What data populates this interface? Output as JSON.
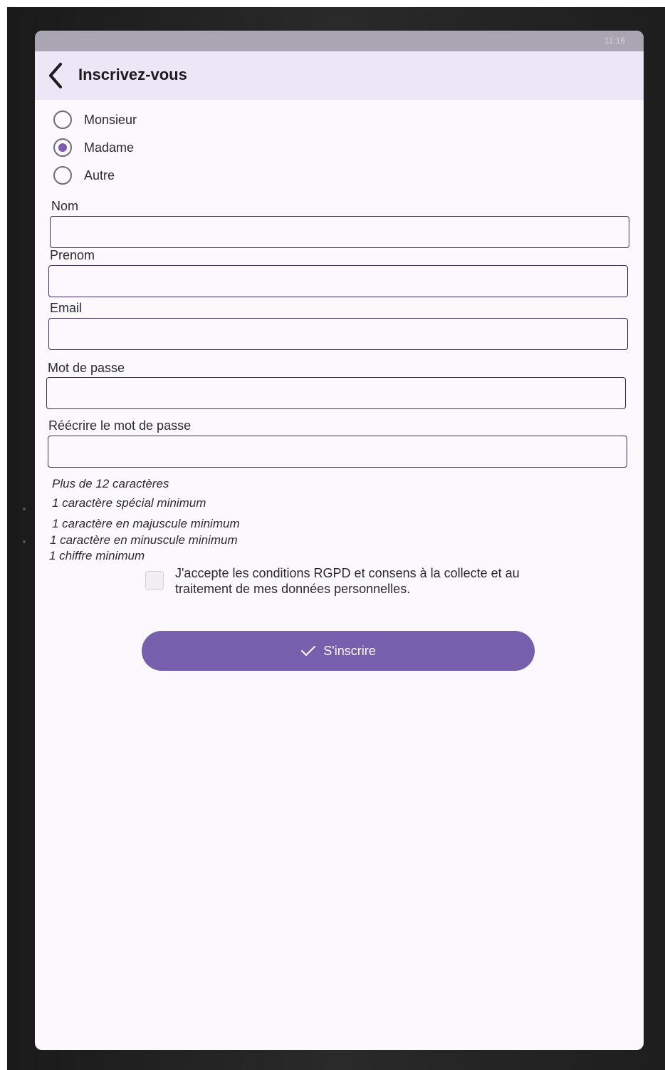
{
  "status_bar": {
    "time": "11:16"
  },
  "app_bar": {
    "title": "Inscrivez-vous",
    "back_icon": "chevron-left-icon"
  },
  "civility": {
    "options": [
      {
        "label": "Monsieur",
        "selected": false
      },
      {
        "label": "Madame",
        "selected": true
      },
      {
        "label": "Autre",
        "selected": false
      }
    ]
  },
  "form": {
    "nom": {
      "label": "Nom",
      "value": ""
    },
    "prenom": {
      "label": "Prenom",
      "value": ""
    },
    "email": {
      "label": "Email",
      "value": ""
    },
    "password": {
      "label": "Mot de passe",
      "value": ""
    },
    "password_confirm": {
      "label": "Réécrire le mot de passe",
      "value": ""
    }
  },
  "password_rules": [
    "Plus de 12 caractères",
    "1 caractère spécial minimum",
    "1 caractère en majuscule minimum",
    "1 caractère en minuscule minimum",
    "1 chiffre minimum"
  ],
  "consent": {
    "checked": false,
    "text": "J'accepte les conditions RGPD et consens à la collecte et au traitement de mes données personnelles."
  },
  "submit": {
    "label": "S'inscrire",
    "icon": "check-icon"
  },
  "colors": {
    "accent": "#765fad",
    "radio_selected": "#7c5db0",
    "input_border": "#3a2a63",
    "app_bar_bg": "#ece7f6",
    "screen_bg": "#fbf8fe"
  }
}
